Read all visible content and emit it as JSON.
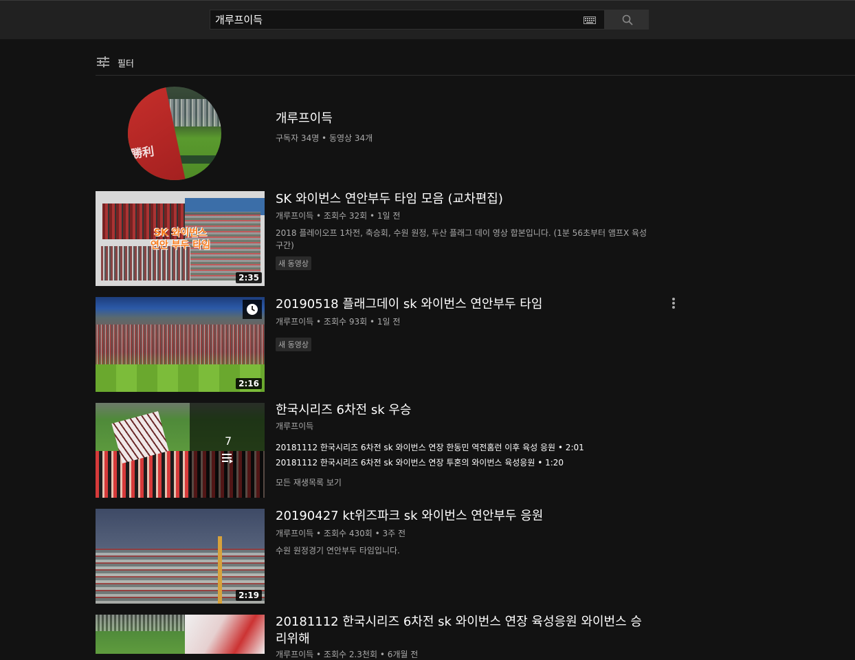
{
  "search": {
    "query": "개루프이득"
  },
  "filter": {
    "label": "필터"
  },
  "channel": {
    "name": "개루프이득",
    "meta": "구독자 34명 • 동영상 34개",
    "avatar_text": "勝利"
  },
  "videos": [
    {
      "title": "SK 와이번스 연안부두 타임 모음 (교차편집)",
      "meta": "개루프이득 • 조회수 32회 • 1일 전",
      "desc_line1": "2018 플레이오프 1차전, 축승회, 수원 원정, 두산 플래그 데이 영상 합본입니다. (1분 56초부터 앰프X 육성",
      "desc_line2": "구간)",
      "badge": "새 동영상",
      "duration": "2:35",
      "thumb_text_1": "SK 와이번스",
      "thumb_text_2": "연안 부두 타임"
    },
    {
      "title": "20190518 플래그데이 sk 와이번스 연안부두 타임",
      "meta": "개루프이득 • 조회수 93회 • 1일 전",
      "badge": "새 동영상",
      "duration": "2:16"
    },
    {
      "title": "한국시리즈 6차전 sk 우승",
      "meta": "개루프이득",
      "count": "7",
      "items": [
        "20181112 한국시리즈 6차전 sk 와이번스 연장 한동민 역전홈런 이후 육성 응원 • 2:01",
        "20181112 한국시리즈 6차전 sk 와이번스 연장 투혼의 와이번스 육성응원 • 1:20"
      ],
      "view_all": "모든 재생목록 보기"
    },
    {
      "title": "20190427 kt위즈파크 sk 와이번스 연안부두 응원",
      "meta": "개루프이득 • 조회수 430회 • 3주 전",
      "desc": "수원 원정경기 연안부두 타임입니다.",
      "duration": "2:19"
    },
    {
      "title_line1": "20181112 한국시리즈 6차전 sk 와이번스 연장 육성응원 와이번스 승",
      "title_line2": "리위해",
      "meta": "개루프이득 • 조회수 2.3천회 • 6개월 전"
    }
  ],
  "colors": {
    "background": "#121212",
    "masthead": "#212121",
    "secondary_text": "#aaaaaa"
  }
}
